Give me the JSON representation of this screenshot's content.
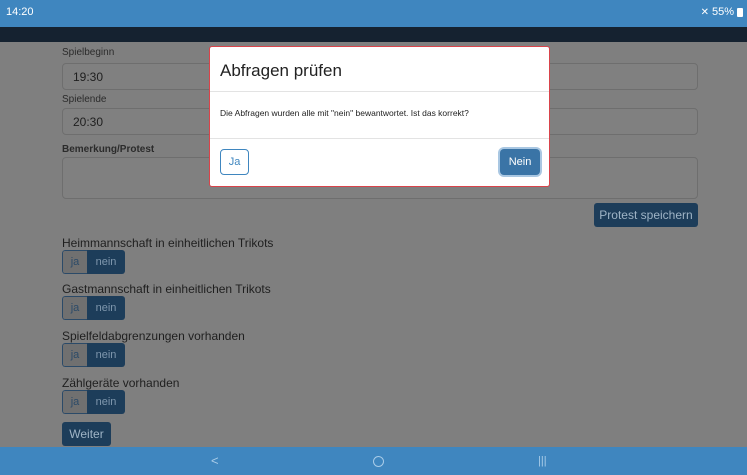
{
  "status": {
    "time": "14:20",
    "battery": "55%"
  },
  "form": {
    "start_label": "Spielbeginn",
    "start_value": "19:30",
    "end_label": "Spielende",
    "end_value": "20:30",
    "remark_label": "Bemerkung/Protest",
    "protest_button": "Protest speichern",
    "questions": [
      {
        "text": "Heimmannschaft in einheitlichen Trikots",
        "ja": "ja",
        "nein": "nein"
      },
      {
        "text": "Gastmannschaft in einheitlichen Trikots",
        "ja": "ja",
        "nein": "nein"
      },
      {
        "text": "Spielfeldabgrenzungen vorhanden",
        "ja": "ja",
        "nein": "nein"
      },
      {
        "text": "Zählgeräte vorhanden",
        "ja": "ja",
        "nein": "nein"
      }
    ],
    "next_button": "Weiter"
  },
  "modal": {
    "title": "Abfragen prüfen",
    "message": "Die Abfragen wurden alle mit \"nein\" bewantwortet. Ist das korrekt?",
    "ja_label": "Ja",
    "nein_label": "Nein"
  },
  "navbar": {
    "back_icon": "<",
    "recents_icon": "|||"
  }
}
